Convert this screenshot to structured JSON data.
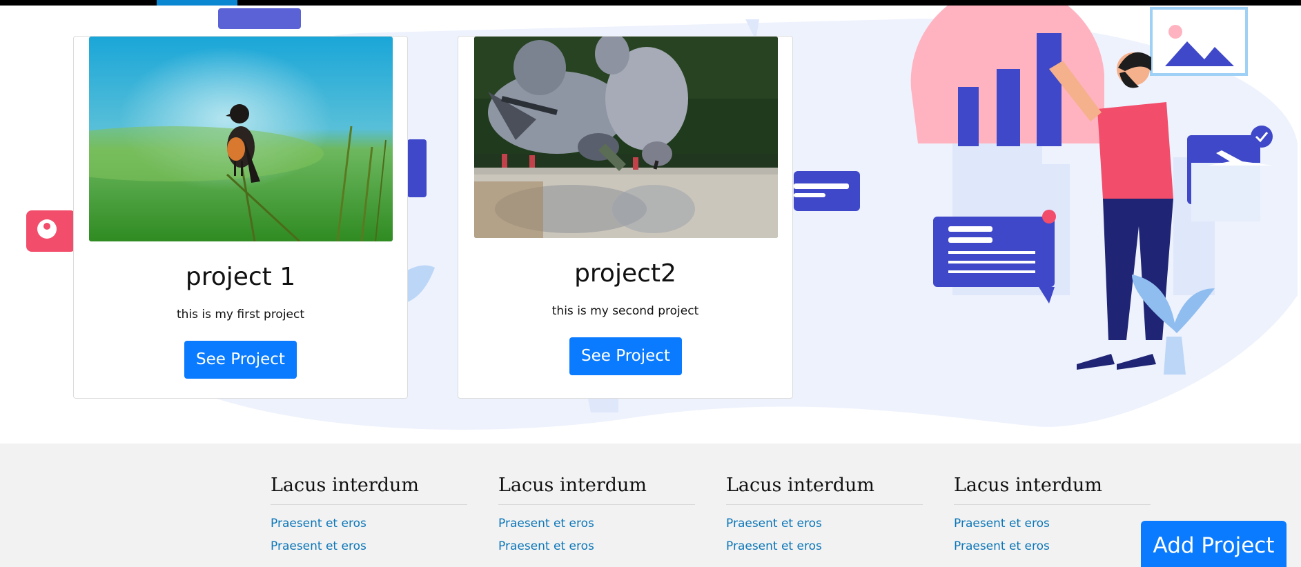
{
  "projects": [
    {
      "title": "project 1",
      "description": "this is my first project",
      "button_label": "See Project",
      "image_subject": "bird-on-grass-stem"
    },
    {
      "title": "project2",
      "description": "this is my second project",
      "button_label": "See Project",
      "image_subject": "pigeons-drinking-water"
    }
  ],
  "footer": {
    "columns": [
      {
        "heading": "Lacus interdum",
        "links": [
          "Praesent et eros",
          "Praesent et eros"
        ]
      },
      {
        "heading": "Lacus interdum",
        "links": [
          "Praesent et eros",
          "Praesent et eros"
        ]
      },
      {
        "heading": "Lacus interdum",
        "links": [
          "Praesent et eros",
          "Praesent et eros"
        ]
      },
      {
        "heading": "Lacus interdum",
        "links": [
          "Praesent et eros",
          "Praesent et eros"
        ]
      }
    ]
  },
  "add_project_label": "Add Project",
  "colors": {
    "primary_button": "#0a7bff",
    "footer_bg": "#f2f2f2",
    "link": "#0b76b8",
    "illustration_blue": "#3f48c8",
    "illustration_pink": "#f24d6a"
  }
}
